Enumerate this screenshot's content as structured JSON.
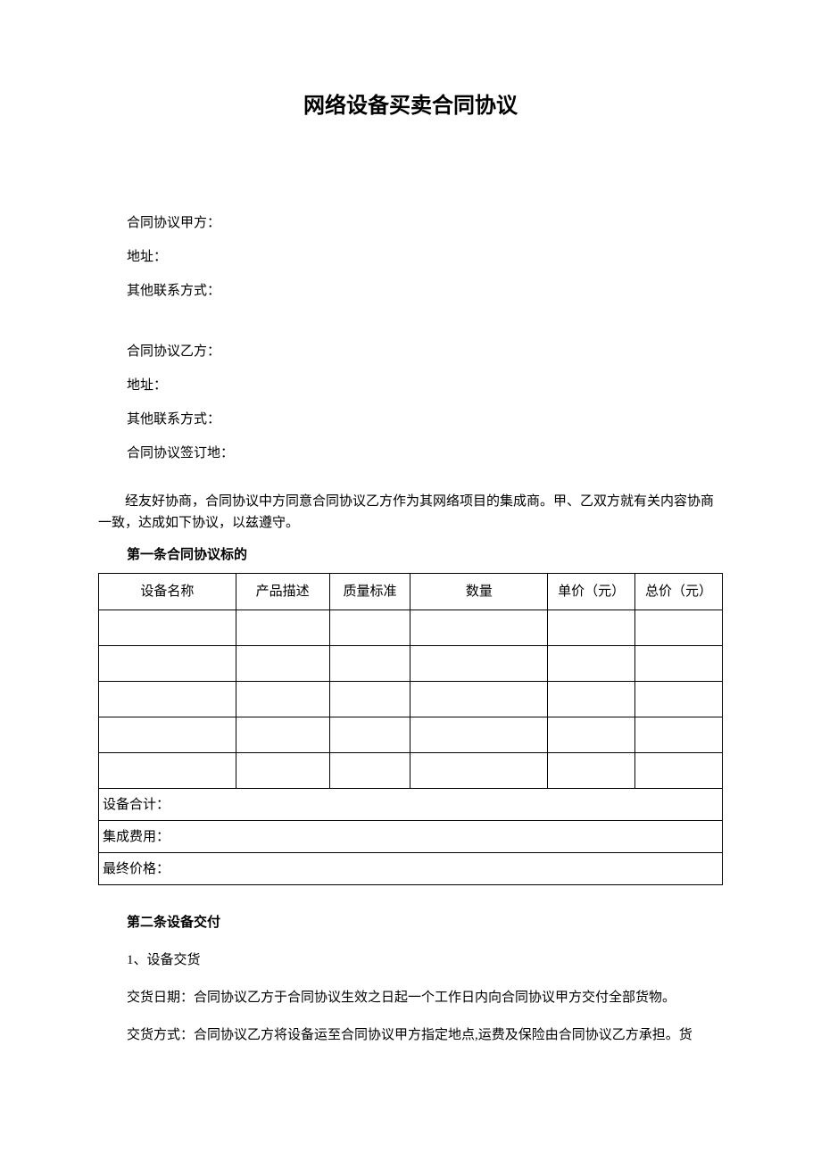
{
  "title": "网络设备买卖合同协议",
  "fields": {
    "partyA": "合同协议甲方：",
    "addressA": "地址：",
    "contactA": "其他联系方式：",
    "partyB": "合同协议乙方：",
    "addressB": "地址：",
    "contactB": "其他联系方式：",
    "signPlace": "合同协议签订地："
  },
  "intro": "经友好协商，合同协议中方同意合同协议乙方作为其网络项目的集成商。甲、乙双方就有关内容协商一致，达成如下协议，以兹遵守。",
  "section1": {
    "heading": "第一条合同协议标的",
    "table": {
      "headers": [
        "设备名称",
        "产品描述",
        "质量标准",
        "数量",
        "单价（元）",
        "总价（元）"
      ],
      "rows": [
        [
          "",
          "",
          "",
          "",
          "",
          ""
        ],
        [
          "",
          "",
          "",
          "",
          "",
          ""
        ],
        [
          "",
          "",
          "",
          "",
          "",
          ""
        ],
        [
          "",
          "",
          "",
          "",
          "",
          ""
        ],
        [
          "",
          "",
          "",
          "",
          "",
          ""
        ]
      ],
      "summaryRows": [
        "设备合计：",
        "集成费用：",
        "最终价格："
      ]
    }
  },
  "section2": {
    "heading": "第二条设备交付",
    "item1": "1、设备交货",
    "deliveryDate": "交货日期：合同协议乙方于合同协议生效之日起一个工作日内向合同协议甲方交付全部货物。",
    "deliveryMethod": "交货方式：合同协议乙方将设备运至合同协议甲方指定地点,运费及保险由合同协议乙方承担。货"
  }
}
